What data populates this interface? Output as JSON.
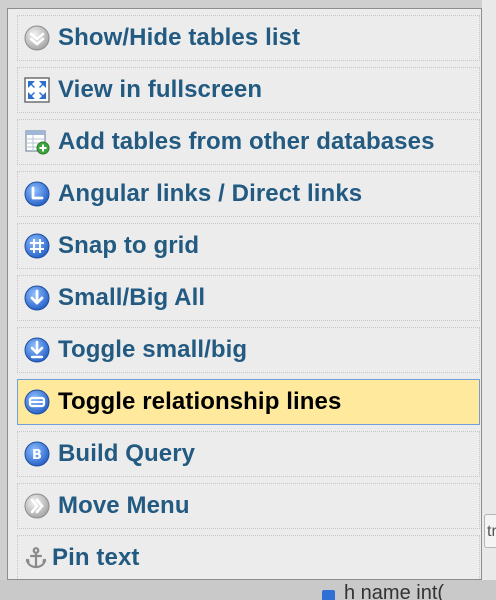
{
  "menu": {
    "items": [
      {
        "label": "Show/Hide tables list",
        "icon": "chevron-down-circle-icon"
      },
      {
        "label": "View in fullscreen",
        "icon": "fullscreen-icon"
      },
      {
        "label": "Add tables from other databases",
        "icon": "add-table-icon"
      },
      {
        "label": "Angular links / Direct links",
        "icon": "angular-links-icon"
      },
      {
        "label": "Snap to grid",
        "icon": "grid-icon"
      },
      {
        "label": "Small/Big All",
        "icon": "download-circle-icon"
      },
      {
        "label": "Toggle small/big",
        "icon": "toggle-size-icon"
      },
      {
        "label": "Toggle relationship lines",
        "icon": "relationship-lines-icon",
        "active": true
      },
      {
        "label": "Build Query",
        "icon": "build-query-icon"
      },
      {
        "label": "Move Menu",
        "icon": "chevron-right-circle-icon"
      },
      {
        "label": "Pin text",
        "icon": "anchor-icon"
      }
    ]
  },
  "background": {
    "peek_tab_text": "tr",
    "peek_bottom_text": "h name   int("
  },
  "colors": {
    "link": "#235a81",
    "active_bg": "#ffe99d",
    "active_border": "#6f9fd6",
    "icon_blue": "#3f7fd8"
  }
}
